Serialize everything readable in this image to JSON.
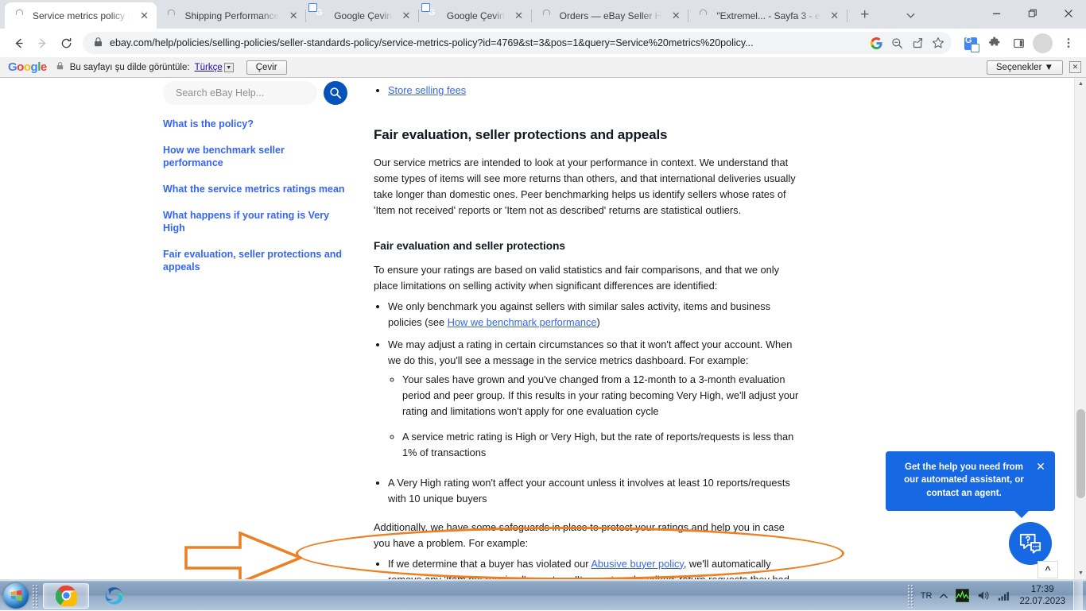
{
  "browser": {
    "tabs": [
      {
        "title": "Service metrics policy |",
        "favicon": "ebay-icon",
        "active": true
      },
      {
        "title": "Shipping Performance",
        "favicon": "ebay-icon",
        "active": false
      },
      {
        "title": "Google Çeviri",
        "favicon": "google-translate-icon",
        "active": false
      },
      {
        "title": "Google Çeviri",
        "favicon": "google-translate-icon",
        "active": false
      },
      {
        "title": "Orders — eBay Seller H",
        "favicon": "ebay-icon",
        "active": false
      },
      {
        "title": "\"Extremel... - Sayfa 3 - e",
        "favicon": "ebay-icon",
        "active": false
      }
    ],
    "new_tab_label": "+",
    "tab_search_label": "⌄",
    "window_controls": {
      "minimize": "🗕",
      "maximize": "🗗",
      "close": "✕"
    },
    "nav": {
      "back": "←",
      "forward": "→",
      "reload": "⟳"
    },
    "omnibox": {
      "lock": "🔒",
      "url": "ebay.com/help/policies/selling-policies/seller-standards-policy/service-metrics-policy?id=4769&st=3&pos=1&query=Service%20metrics%20policy..."
    },
    "toolbar_icons": [
      {
        "name": "google-icon",
        "glyph": "G"
      },
      {
        "name": "zoom-out-icon",
        "glyph": "⊖"
      },
      {
        "name": "share-icon",
        "glyph": "↱"
      },
      {
        "name": "bookmark-star-icon",
        "glyph": "☆"
      },
      {
        "name": "google-translate-icon",
        "glyph": "G"
      },
      {
        "name": "extensions-puzzle-icon",
        "glyph": "🧩"
      },
      {
        "name": "side-panel-icon",
        "glyph": "◨"
      },
      {
        "name": "profile-avatar",
        "glyph": ""
      },
      {
        "name": "chrome-menu-icon",
        "glyph": "⋮"
      }
    ]
  },
  "translate_bar": {
    "logo": "Google",
    "lock": "🔒",
    "label": "Bu sayfayı şu dilde görüntüle:",
    "language": "Türkçe",
    "translate_button": "Çevir",
    "options_button": "Seçenekler ▼",
    "close_button": "✕"
  },
  "sidebar": {
    "search_placeholder": "Search eBay Help...",
    "search_value": "",
    "links": [
      "What is the policy?",
      "How we benchmark seller performance",
      "What the service metrics ratings mean",
      "What happens if your rating is Very High",
      "Fair evaluation, seller protections and appeals"
    ]
  },
  "article": {
    "top_partial_link": "Store selling fees",
    "heading": "Fair evaluation, seller protections and appeals",
    "intro": "Our service metrics are intended to look at your performance in context. We understand that some types of items will see more returns than others, and that international deliveries usually take longer than domestic ones. Peer benchmarking helps us identify sellers whose rates of 'Item not received' reports or 'Item not as described' returns are statistical outliers.",
    "subheading": "Fair evaluation and seller protections",
    "lead": "To ensure your ratings are based on valid statistics and fair comparisons, and that we only place limitations on selling activity when significant differences are identified:",
    "bullet1_before": "We only benchmark you against sellers with similar sales activity, items and business policies (see ",
    "bullet1_link": "How we benchmark performance",
    "bullet1_after": ")",
    "bullet2": "We may adjust a rating in certain circumstances so that it won't affect your account. When we do this, you'll see a message in the service metrics dashboard. For example:",
    "subbullet1": "Your sales have grown and you've changed from a 12-month to a 3-month evaluation period and peer group. If this results in your rating becoming Very High, we'll adjust your rating and limitations won't apply for one evaluation cycle",
    "subbullet2": "A service metric rating is High or Very High, but the rate of reports/requests is less than 1% of transactions",
    "highlighted_bullet": "A Very High rating won't affect your account unless it involves at least 10 reports/requests with 10 unique buyers",
    "closing_para": "Additionally, we have some safeguards in place to protect your ratings and help you in case you have a problem. For example:",
    "last_bullet_before": "If we determine that a buyer has violated our ",
    "last_bullet_link": "Abusive buyer policy",
    "last_bullet_after": ", we'll automatically remove any 'Item not received' reports or 'Item not as described' return requests they had filed from service"
  },
  "annotation": {
    "color": "#ed8022",
    "shapes": [
      "arrow-right",
      "ellipse-highlight"
    ]
  },
  "chat_widget": {
    "tooltip": "Get the help you need from our automated assistant, or contact an agent.",
    "close_label": "✕",
    "fab_icon": "chat-question-icon"
  },
  "page_controls": {
    "back_to_top": "^",
    "scroll_up": "▲",
    "scroll_down": "▼"
  },
  "taskbar": {
    "start_label": "start-orb",
    "items": [
      {
        "name": "chrome-icon",
        "running": true
      },
      {
        "name": "edge-icon",
        "running": false
      }
    ],
    "tray": {
      "language": "TR",
      "show_hidden": "▲",
      "icons": [
        "network-monitor-icon",
        "volume-icon",
        "signal-icon"
      ],
      "time": "17:39",
      "date": "22.07.2023"
    }
  }
}
